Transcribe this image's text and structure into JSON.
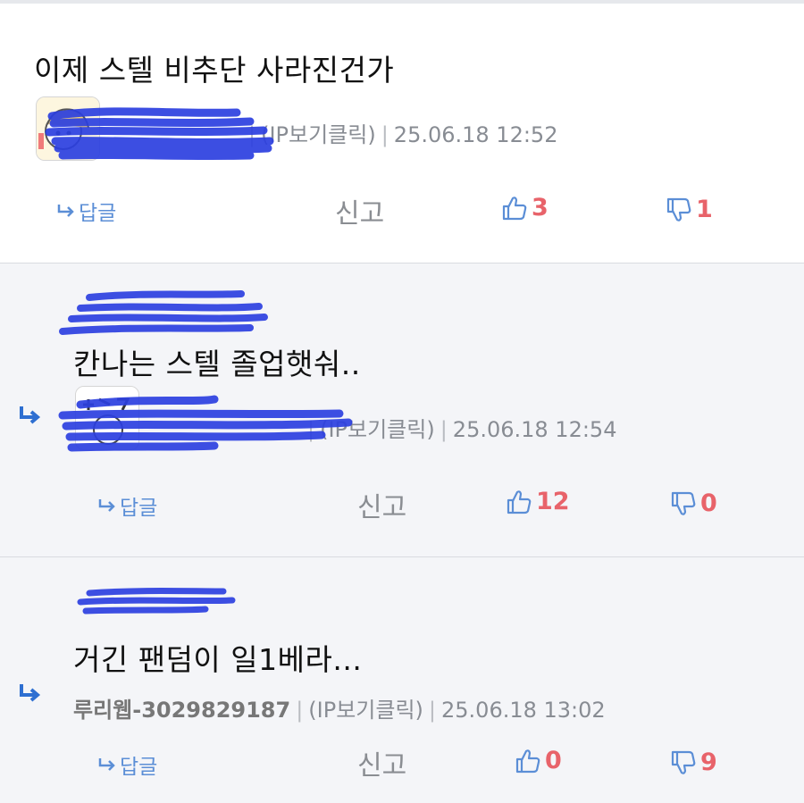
{
  "comments": [
    {
      "text": "이제 스텔 비추단 사라진건가",
      "nickname": "",
      "ip_label": "(IP보기클릭)",
      "timestamp": "25.06.18 12:52",
      "reply_label": "답글",
      "report_label": "신고",
      "likes": "3",
      "dislikes": "1"
    },
    {
      "quoted_nickname": "",
      "text": "칸나는 스텔 졸업햇숴..",
      "nickname": "",
      "ip_label": "(IP보기클릭)",
      "timestamp": "25.06.18 12:54",
      "reply_label": "답글",
      "report_label": "신고",
      "likes": "12",
      "dislikes": "0"
    },
    {
      "quoted_nickname": "",
      "text": "거긴 팬덤이 일1베라...",
      "nickname": "루리웹-3029829187",
      "ip_label": "(IP보기클릭)",
      "timestamp": "25.06.18 13:02",
      "reply_label": "답글",
      "report_label": "신고",
      "likes": "0",
      "dislikes": "9"
    }
  ],
  "colors": {
    "accent": "#5b8ed6",
    "vote_count": "#e8636a",
    "scribble": "#2b3fe0",
    "reply_background": "#f4f5f8"
  },
  "icons": {
    "reply": "reply-arrow-icon",
    "like": "thumbs-up-icon",
    "dislike": "thumbs-down-icon",
    "nested": "nested-reply-arrow-icon"
  }
}
